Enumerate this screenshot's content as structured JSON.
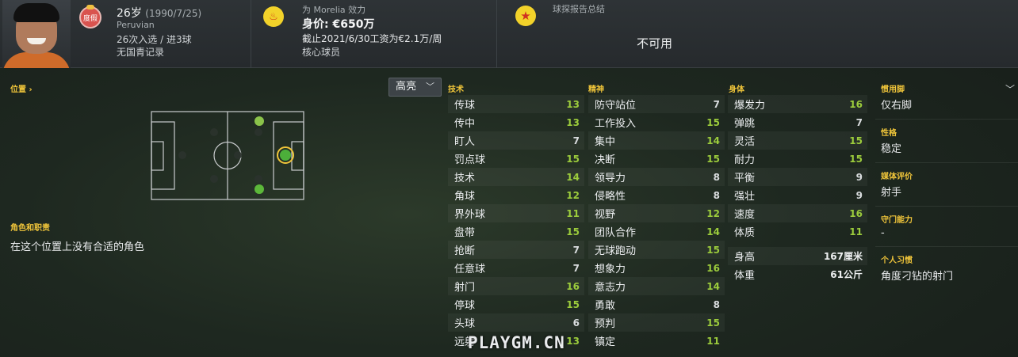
{
  "header": {
    "holiday_badge": "度假",
    "age": "26岁",
    "dob": "(1990/7/25)",
    "nationality": "Peruvian",
    "caps": "26次入选 / 进3球",
    "youth": "无国青记录",
    "club": "为 Morelia 效力",
    "value": "身价: €650万",
    "wage": "截止2021/6/30工资为€2.1万/周",
    "squad_status": "核心球员",
    "scout_title": "球探报告总结",
    "scout_value": "不可用"
  },
  "position": {
    "title": "位置 ›",
    "highlight_button": "高亮",
    "roles_title": "角色和职责",
    "roles_text": "在这个位置上没有合适的角色"
  },
  "columns": {
    "technical": "技术",
    "mental": "精神",
    "physical": "身体"
  },
  "technical": [
    {
      "name": "传球",
      "value": "13",
      "color": "#9ccc3c"
    },
    {
      "name": "传中",
      "value": "13",
      "color": "#9ccc3c"
    },
    {
      "name": "盯人",
      "value": "7",
      "color": "#d9dcde"
    },
    {
      "name": "罚点球",
      "value": "15",
      "color": "#9ccc3c"
    },
    {
      "name": "技术",
      "value": "14",
      "color": "#9ccc3c"
    },
    {
      "name": "角球",
      "value": "12",
      "color": "#9ccc3c"
    },
    {
      "name": "界外球",
      "value": "11",
      "color": "#9ccc3c"
    },
    {
      "name": "盘带",
      "value": "15",
      "color": "#9ccc3c"
    },
    {
      "name": "抢断",
      "value": "7",
      "color": "#d9dcde"
    },
    {
      "name": "任意球",
      "value": "7",
      "color": "#d9dcde"
    },
    {
      "name": "射门",
      "value": "16",
      "color": "#9ccc3c"
    },
    {
      "name": "停球",
      "value": "15",
      "color": "#9ccc3c"
    },
    {
      "name": "头球",
      "value": "6",
      "color": "#d9dcde"
    },
    {
      "name": "远射",
      "value": "13",
      "color": "#9ccc3c"
    }
  ],
  "mental": [
    {
      "name": "防守站位",
      "value": "7",
      "color": "#d9dcde"
    },
    {
      "name": "工作投入",
      "value": "15",
      "color": "#9ccc3c"
    },
    {
      "name": "集中",
      "value": "14",
      "color": "#9ccc3c"
    },
    {
      "name": "决断",
      "value": "15",
      "color": "#9ccc3c"
    },
    {
      "name": "领导力",
      "value": "8",
      "color": "#d9dcde"
    },
    {
      "name": "侵略性",
      "value": "8",
      "color": "#d9dcde"
    },
    {
      "name": "视野",
      "value": "12",
      "color": "#9ccc3c"
    },
    {
      "name": "团队合作",
      "value": "14",
      "color": "#9ccc3c"
    },
    {
      "name": "无球跑动",
      "value": "15",
      "color": "#9ccc3c"
    },
    {
      "name": "想象力",
      "value": "16",
      "color": "#9ccc3c"
    },
    {
      "name": "意志力",
      "value": "14",
      "color": "#9ccc3c"
    },
    {
      "name": "勇敢",
      "value": "8",
      "color": "#d9dcde"
    },
    {
      "name": "预判",
      "value": "15",
      "color": "#9ccc3c"
    },
    {
      "name": "镇定",
      "value": "11",
      "color": "#9ccc3c"
    }
  ],
  "physical": [
    {
      "name": "爆发力",
      "value": "16",
      "color": "#9ccc3c"
    },
    {
      "name": "弹跳",
      "value": "7",
      "color": "#d9dcde"
    },
    {
      "name": "灵活",
      "value": "15",
      "color": "#9ccc3c"
    },
    {
      "name": "耐力",
      "value": "15",
      "color": "#9ccc3c"
    },
    {
      "name": "平衡",
      "value": "9",
      "color": "#d9dcde"
    },
    {
      "name": "强壮",
      "value": "9",
      "color": "#d9dcde"
    },
    {
      "name": "速度",
      "value": "16",
      "color": "#9ccc3c"
    },
    {
      "name": "体质",
      "value": "11",
      "color": "#9ccc3c"
    }
  ],
  "physical_extra": [
    {
      "name": "身高",
      "value": "167厘米"
    },
    {
      "name": "体重",
      "value": "61公斤"
    }
  ],
  "info": {
    "foot_label": "惯用脚",
    "foot_value": "仅右脚",
    "personality_label": "性格",
    "personality_value": "稳定",
    "media_label": "媒体评价",
    "media_value": "射手",
    "gk_label": "守门能力",
    "gk_value": "-",
    "traits_label": "个人习惯",
    "traits_value": "角度刁钻的射门"
  },
  "watermark": "PLAYGM.CN"
}
